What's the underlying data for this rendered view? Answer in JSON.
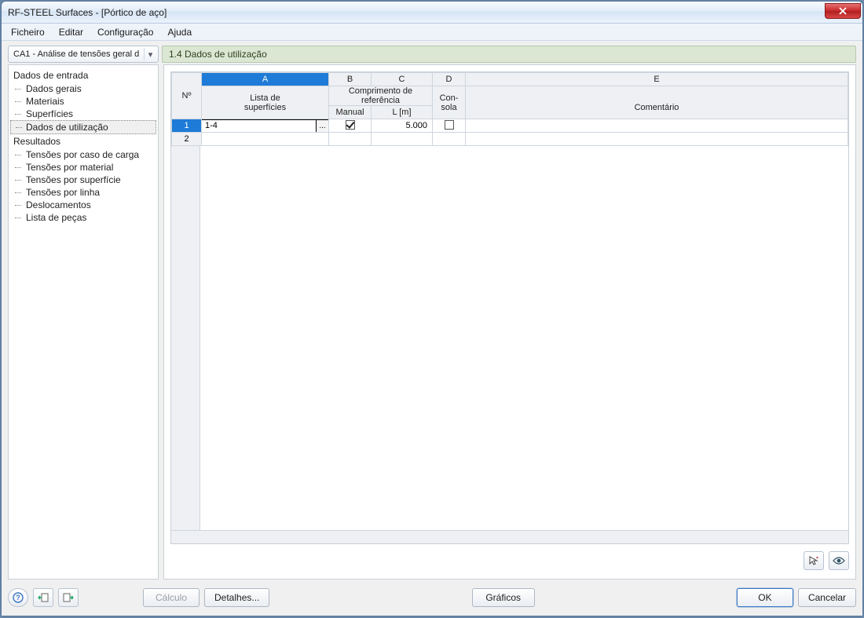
{
  "title": "RF-STEEL Surfaces - [Pórtico de aço]",
  "menu": {
    "file": "Ficheiro",
    "edit": "Editar",
    "config": "Configuração",
    "help": "Ajuda"
  },
  "combo": {
    "text": "CA1 - Análise de tensões geral d"
  },
  "panel_title": "1.4 Dados de utilização",
  "nav": {
    "group_input": "Dados de entrada",
    "input_items": [
      "Dados gerais",
      "Materiais",
      "Superfícies",
      "Dados de utilização"
    ],
    "group_results": "Resultados",
    "result_items": [
      "Tensões por caso de carga",
      "Tensões por material",
      "Tensões por superfície",
      "Tensões por linha",
      "Deslocamentos",
      "Lista de peças"
    ],
    "selected": "Dados de utilização"
  },
  "grid": {
    "col_letters": [
      "A",
      "B",
      "C",
      "D",
      "E"
    ],
    "row_header": "Nº",
    "h_a1": "Lista de",
    "h_a2": "superfícies",
    "h_bc1": "Comprimento de referência",
    "h_b2": "Manual",
    "h_c2": "L [m]",
    "h_d1": "Con-",
    "h_d2": "sola",
    "h_e2": "Comentário",
    "rows": [
      {
        "n": "1",
        "a": "1-4",
        "b_checked": true,
        "c": "5.000",
        "d_checked": false,
        "e": ""
      },
      {
        "n": "2",
        "a": "",
        "b_checked": null,
        "c": "",
        "d_checked": null,
        "e": ""
      }
    ]
  },
  "buttons": {
    "calc": "Cálculo",
    "details": "Detalhes...",
    "graphics": "Gráficos",
    "ok": "OK",
    "cancel": "Cancelar"
  }
}
